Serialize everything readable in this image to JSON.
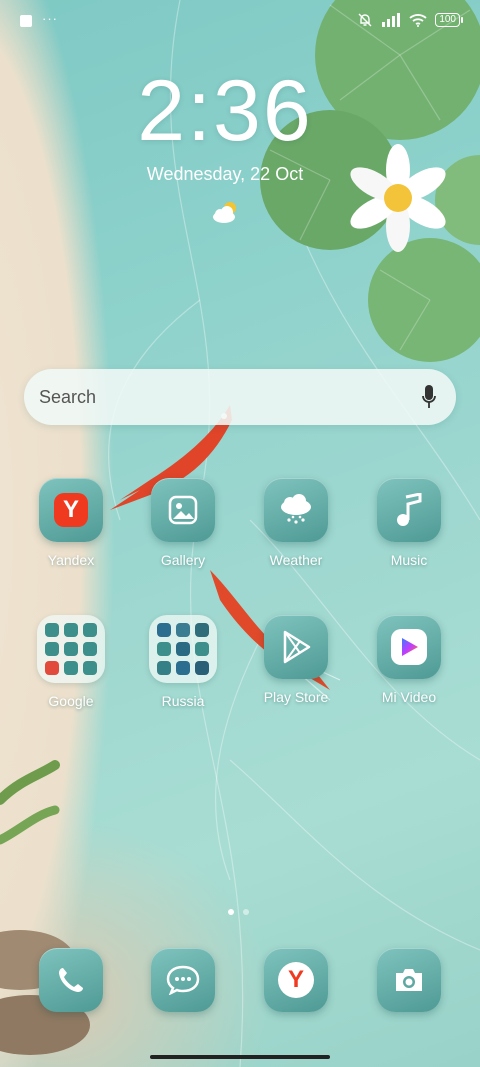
{
  "status": {
    "dots": "···",
    "battery": "100"
  },
  "lockscreen": {
    "time": "2:36",
    "date": "Wednesday, 22 Oct"
  },
  "search": {
    "placeholder": "Search"
  },
  "apps": [
    {
      "label": "Yandex",
      "icon": "yandex-browser-icon"
    },
    {
      "label": "Gallery",
      "icon": "gallery-icon"
    },
    {
      "label": "Weather",
      "icon": "weather-icon"
    },
    {
      "label": "Music",
      "icon": "music-icon"
    },
    {
      "label": "Google",
      "icon": "google-folder-icon"
    },
    {
      "label": "Russia",
      "icon": "russia-folder-icon"
    },
    {
      "label": "Play Store",
      "icon": "play-store-icon"
    },
    {
      "label": "Mi Video",
      "icon": "mi-video-icon"
    }
  ],
  "dock": [
    {
      "icon": "phone-icon"
    },
    {
      "icon": "messages-icon"
    },
    {
      "icon": "yandex-icon"
    },
    {
      "icon": "camera-icon"
    }
  ],
  "pager": {
    "pages": 2,
    "current": 1
  },
  "colors": {
    "water": "#8fd2cc",
    "tile": "#5fa8a2",
    "koi": "#e0452a",
    "lily_pad": "#6fae6c"
  }
}
